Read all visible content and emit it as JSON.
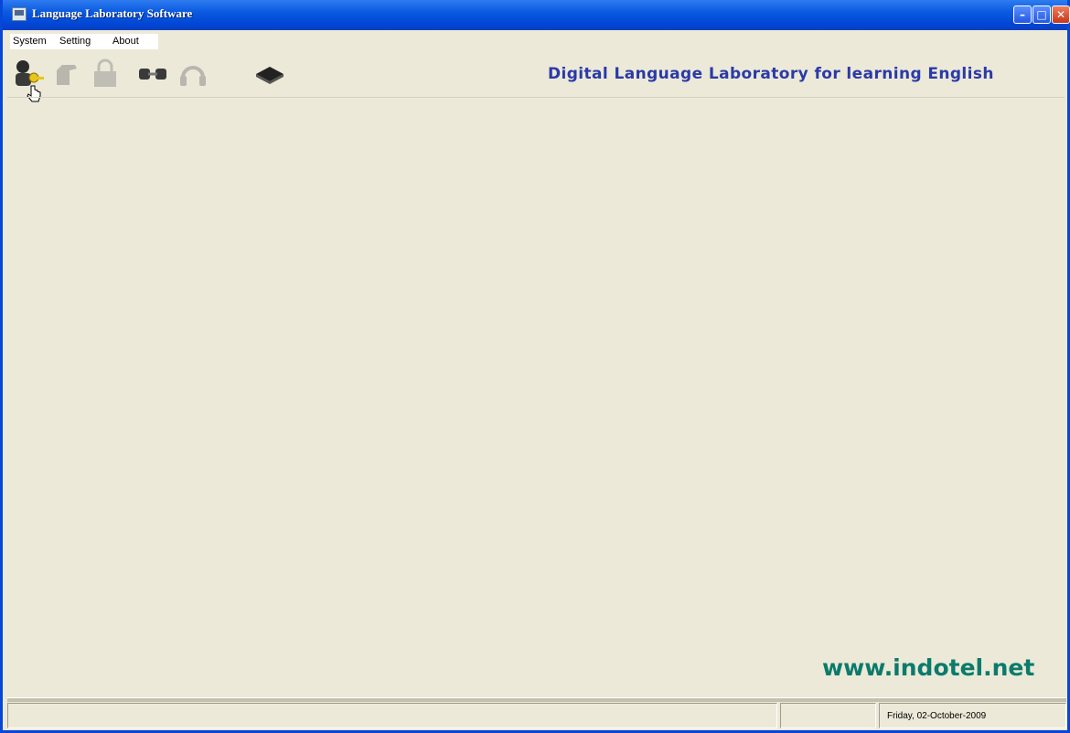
{
  "window": {
    "title": "Language Laboratory Software"
  },
  "menu": {
    "items": [
      "System",
      "Setting",
      "About"
    ]
  },
  "toolbar": {
    "buttons": [
      {
        "icon": "teacher-key-icon",
        "enabled": true
      },
      {
        "icon": "hand-icon",
        "enabled": false
      },
      {
        "icon": "lock-icon",
        "enabled": false
      },
      {
        "icon": "connect-icon",
        "enabled": true
      },
      {
        "icon": "headset-icon",
        "enabled": false
      },
      {
        "icon": "chip-icon",
        "enabled": true
      }
    ]
  },
  "header": {
    "tagline": "Digital Language Laboratory for learning English"
  },
  "footer": {
    "website": "www.indotel.net"
  },
  "statusbar": {
    "date": "Friday, 02-October-2009"
  },
  "colors": {
    "title_bar": "#0046d5",
    "tagline": "#2a3aa8",
    "website": "#0b7b6b",
    "background": "#ece9d8"
  }
}
